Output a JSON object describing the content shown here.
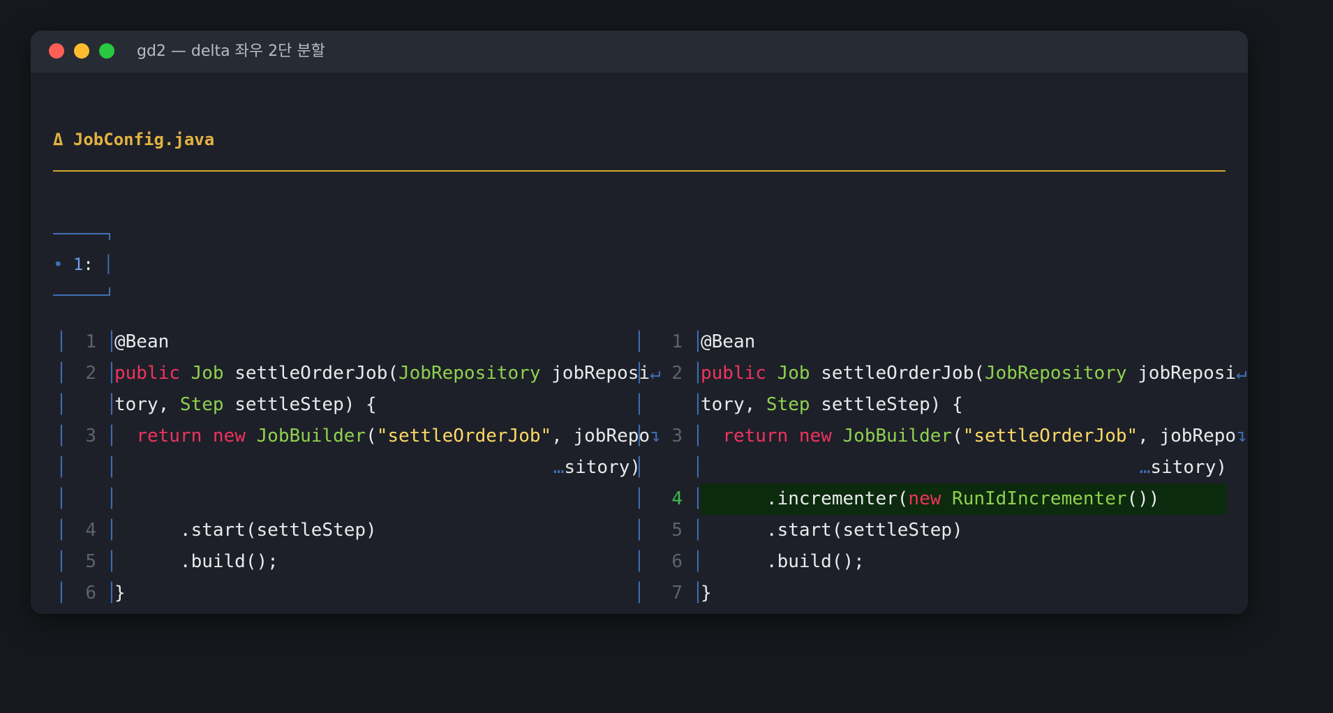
{
  "window": {
    "title": "gd2 — delta 좌우 2단 분할",
    "colors": {
      "close": "#ff5f57",
      "minimize": "#febc2e",
      "zoom": "#28c840"
    }
  },
  "file": {
    "label": "Δ JobConfig.java"
  },
  "hunk": {
    "bullet": "•",
    "number": "1",
    "suffix": ":"
  },
  "colors": {
    "keyword": "#f0335f",
    "type": "#8fd14f",
    "string": "#ffd866",
    "added_bg": "#0c2a0d",
    "border": "#3f6fb5",
    "accent": "#e3b341"
  },
  "left_pane": {
    "rows": [
      {
        "num": "1",
        "segments": [
          {
            "t": "@Bean",
            "c": "pl"
          }
        ]
      },
      {
        "num": "2",
        "wrap": "↵",
        "segments": [
          {
            "t": "public ",
            "c": "kw"
          },
          {
            "t": "Job",
            "c": "ty"
          },
          {
            "t": " settleOrderJob(",
            "c": "pl"
          },
          {
            "t": "JobRepository",
            "c": "ty"
          },
          {
            "t": " jobReposi",
            "c": "pl"
          }
        ]
      },
      {
        "num": "",
        "segments": [
          {
            "t": "tory, ",
            "c": "pl"
          },
          {
            "t": "Step",
            "c": "ty"
          },
          {
            "t": " settleStep) {",
            "c": "pl"
          }
        ]
      },
      {
        "num": "3",
        "wrap": "↴",
        "segments": [
          {
            "t": "  ",
            "c": "pl"
          },
          {
            "t": "return",
            "c": "kw"
          },
          {
            "t": " ",
            "c": "pl"
          },
          {
            "t": "new",
            "c": "kw"
          },
          {
            "t": " ",
            "c": "pl"
          },
          {
            "t": "JobBuilder",
            "c": "ty"
          },
          {
            "t": "(",
            "c": "pl"
          },
          {
            "t": "\"settleOrderJob\"",
            "c": "st"
          },
          {
            "t": ", jobRepo",
            "c": "pl"
          }
        ]
      },
      {
        "num": "",
        "align": "right",
        "segments": [
          {
            "t": "…",
            "c": "wrap"
          },
          {
            "t": "sitory)",
            "c": "pl"
          }
        ]
      },
      {
        "num": "",
        "segments": []
      },
      {
        "num": "4",
        "segments": [
          {
            "t": "      .start(settleStep)",
            "c": "pl"
          }
        ]
      },
      {
        "num": "5",
        "segments": [
          {
            "t": "      .build();",
            "c": "pl"
          }
        ]
      },
      {
        "num": "6",
        "segments": [
          {
            "t": "}",
            "c": "pl"
          }
        ]
      }
    ]
  },
  "right_pane": {
    "rows": [
      {
        "num": "1",
        "segments": [
          {
            "t": "@Bean",
            "c": "pl"
          }
        ]
      },
      {
        "num": "2",
        "wrap": "↵",
        "segments": [
          {
            "t": "public ",
            "c": "kw"
          },
          {
            "t": "Job",
            "c": "ty"
          },
          {
            "t": " settleOrderJob(",
            "c": "pl"
          },
          {
            "t": "JobRepository",
            "c": "ty"
          },
          {
            "t": " jobReposi",
            "c": "pl"
          }
        ]
      },
      {
        "num": "",
        "segments": [
          {
            "t": "tory, ",
            "c": "pl"
          },
          {
            "t": "Step",
            "c": "ty"
          },
          {
            "t": " settleStep) {",
            "c": "pl"
          }
        ]
      },
      {
        "num": "3",
        "wrap": "↴",
        "segments": [
          {
            "t": "  ",
            "c": "pl"
          },
          {
            "t": "return",
            "c": "kw"
          },
          {
            "t": " ",
            "c": "pl"
          },
          {
            "t": "new",
            "c": "kw"
          },
          {
            "t": " ",
            "c": "pl"
          },
          {
            "t": "JobBuilder",
            "c": "ty"
          },
          {
            "t": "(",
            "c": "pl"
          },
          {
            "t": "\"settleOrderJob\"",
            "c": "st"
          },
          {
            "t": ", jobRepo",
            "c": "pl"
          }
        ]
      },
      {
        "num": "",
        "align": "right",
        "segments": [
          {
            "t": "…",
            "c": "wrap"
          },
          {
            "t": "sitory)",
            "c": "pl"
          }
        ]
      },
      {
        "num": "4",
        "added": true,
        "segments": [
          {
            "t": "      .incrementer(",
            "c": "pl"
          },
          {
            "t": "new",
            "c": "kw"
          },
          {
            "t": " ",
            "c": "pl"
          },
          {
            "t": "RunIdIncrementer",
            "c": "ty"
          },
          {
            "t": "())",
            "c": "pl"
          }
        ]
      },
      {
        "num": "5",
        "segments": [
          {
            "t": "      .start(settleStep)",
            "c": "pl"
          }
        ]
      },
      {
        "num": "6",
        "segments": [
          {
            "t": "      .build();",
            "c": "pl"
          }
        ]
      },
      {
        "num": "7",
        "segments": [
          {
            "t": "}",
            "c": "pl"
          }
        ]
      }
    ]
  }
}
